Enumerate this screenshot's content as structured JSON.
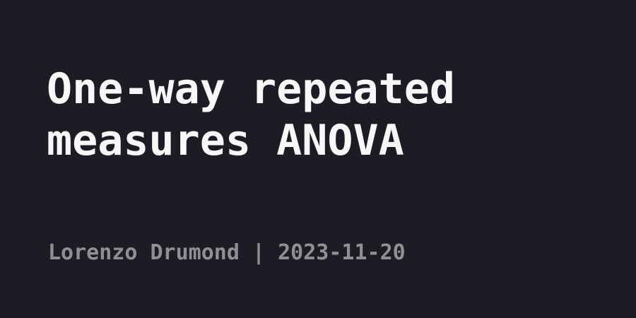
{
  "post": {
    "title": "One-way repeated\nmeasures ANOVA",
    "author": "Lorenzo Drumond",
    "separator": "|",
    "date": "2023-11-20"
  },
  "colors": {
    "background": "#1b1c24",
    "title": "#f7f7f8",
    "byline": "#8f8f96"
  }
}
